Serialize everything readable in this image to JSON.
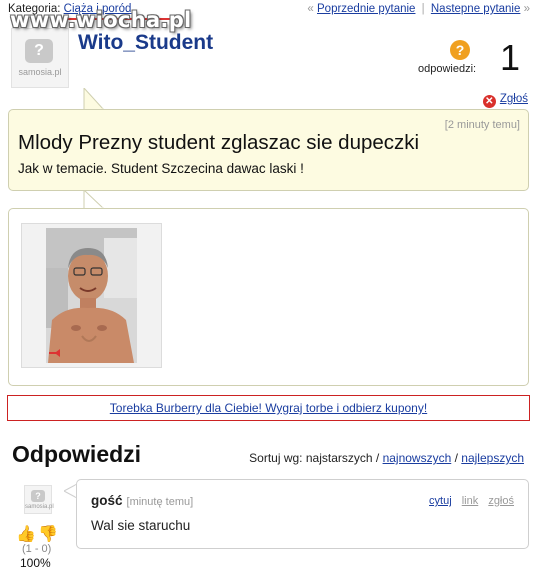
{
  "watermark": "www.wiocha.pl",
  "top": {
    "category_label": "Kategoria:",
    "category_link": "Ciąża i poród",
    "prev_arrow": "«",
    "prev": "Poprzednie pytanie",
    "sep": "|",
    "next": "Nastepne pytanie",
    "next_arrow": "»"
  },
  "author": {
    "avatar_label": "samosia.pl",
    "username": "Wito_Student"
  },
  "answers": {
    "icon": "question-icon",
    "label": "odpowiedzi:",
    "count": "1"
  },
  "report_label": "Zgłoś",
  "question": {
    "time": "[2 minuty temu]",
    "title": "Mlody Prezny student zglaszac sie dupeczki",
    "body": "Jak w temacie. Student Szczecina dawac laski !"
  },
  "ad_text": "Torebka Burberry dla Ciebie! Wygraj torbe i odbierz kupony!",
  "answers_section": {
    "title": "Odpowiedzi",
    "sort_label": "Sortuj wg: najstarszych /",
    "sort_newest": "najnowszych",
    "sort_sep": "/",
    "sort_best": "najlepszych"
  },
  "answer": {
    "avatar_label": "samosia.pl",
    "author": "gość",
    "time": "[minutę temu]",
    "quote": "cytuj",
    "link": "link",
    "report": "zgłoś",
    "text": "Wal sie staruchu",
    "vote_ratio": "(1 - 0)",
    "vote_pct": "100%"
  },
  "colors": {
    "question_bg": "#fdfbe1",
    "link": "#1a3da0",
    "username": "#1a3a8a",
    "ad_border": "#cc2222"
  }
}
